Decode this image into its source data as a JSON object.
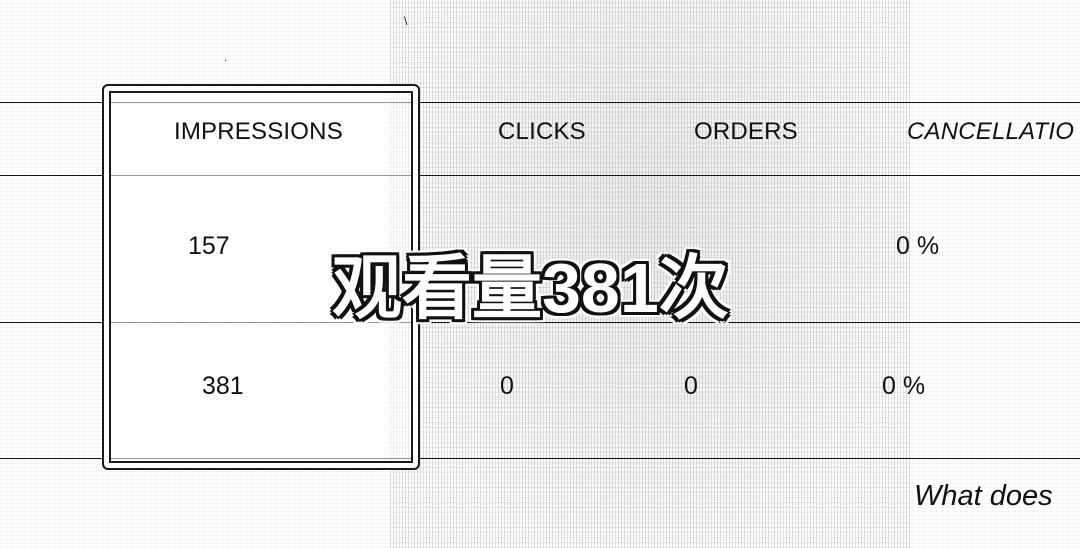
{
  "table": {
    "headers": {
      "impressions": "IMPRESSIONS",
      "clicks": "CLICKS",
      "orders": "ORDERS",
      "cancellations": "CANCELLATIO"
    },
    "rows": [
      {
        "impressions": "157",
        "clicks": "",
        "orders": "",
        "cancellations": "0 %"
      },
      {
        "impressions": "381",
        "clicks": "0",
        "orders": "0",
        "cancellations": "0 %"
      }
    ]
  },
  "overlay": {
    "caption": "观看量381次"
  },
  "footer": {
    "help_text": "What does"
  }
}
